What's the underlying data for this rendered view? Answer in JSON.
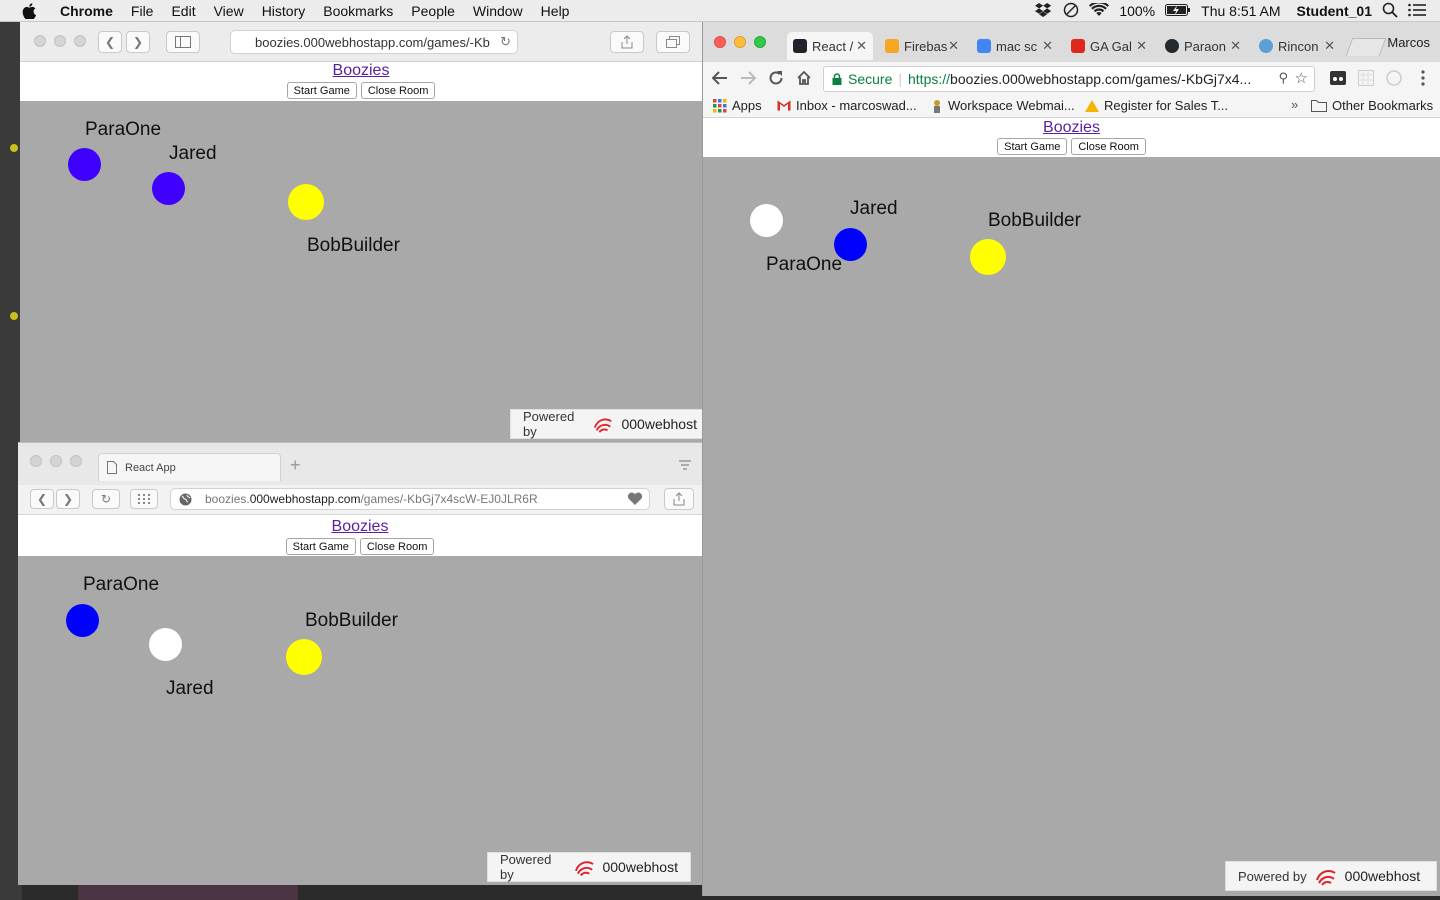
{
  "menubar": {
    "app_name": "Chrome",
    "menus": [
      "File",
      "Edit",
      "View",
      "History",
      "Bookmarks",
      "People",
      "Window",
      "Help"
    ],
    "battery": "100%",
    "clock": "Thu 8:51 AM",
    "user": "Student_01"
  },
  "game": {
    "title": "Boozies",
    "start_label": "Start Game",
    "close_label": "Close Room",
    "powered_by": "Powered by",
    "host_brand": "000webhost"
  },
  "safari_top": {
    "url": "boozies.000webhostapp.com/games/-Kb",
    "players": [
      {
        "name": "ParaOne",
        "color": "#3f00ff"
      },
      {
        "name": "Jared",
        "color": "#3f00ff"
      },
      {
        "name": "BobBuilder",
        "color": "#ffff00"
      }
    ]
  },
  "safari_bottom": {
    "tab_title": "React App",
    "url_domain_prefix": "boozies.",
    "url_domain": "000webhostapp.com",
    "url_path": "/games/-KbGj7x4scW-EJ0JLR6R",
    "players": [
      {
        "name": "ParaOne",
        "color": "#0000ff"
      },
      {
        "name": "Jared",
        "color": "#ffffff"
      },
      {
        "name": "BobBuilder",
        "color": "#ffff00"
      }
    ]
  },
  "chrome": {
    "profile": "Marcos",
    "tabs": [
      {
        "title": "React /",
        "color": "#20232a"
      },
      {
        "title": "Firebas",
        "color": "#f5a623"
      },
      {
        "title": "mac sc",
        "color": "#4285f4"
      },
      {
        "title": "GA Gal",
        "color": "#e0271b"
      },
      {
        "title": "Paraon",
        "color": "#24292e"
      },
      {
        "title": "Rincon",
        "color": "#5aa0d8"
      }
    ],
    "secure_label": "Secure",
    "url_scheme": "https://",
    "url_rest": "boozies.000webhostapp.com/games/-KbGj7x4...",
    "bookmarks": [
      {
        "label": "Apps"
      },
      {
        "label": "Inbox - marcoswad..."
      },
      {
        "label": "Workspace Webmai..."
      },
      {
        "label": "Register for Sales T..."
      }
    ],
    "other_bookmarks": "Other Bookmarks",
    "players": [
      {
        "name": "ParaOne",
        "color": "#ffffff"
      },
      {
        "name": "Jared",
        "color": "#0000ff"
      },
      {
        "name": "BobBuilder",
        "color": "#ffff00"
      }
    ]
  }
}
